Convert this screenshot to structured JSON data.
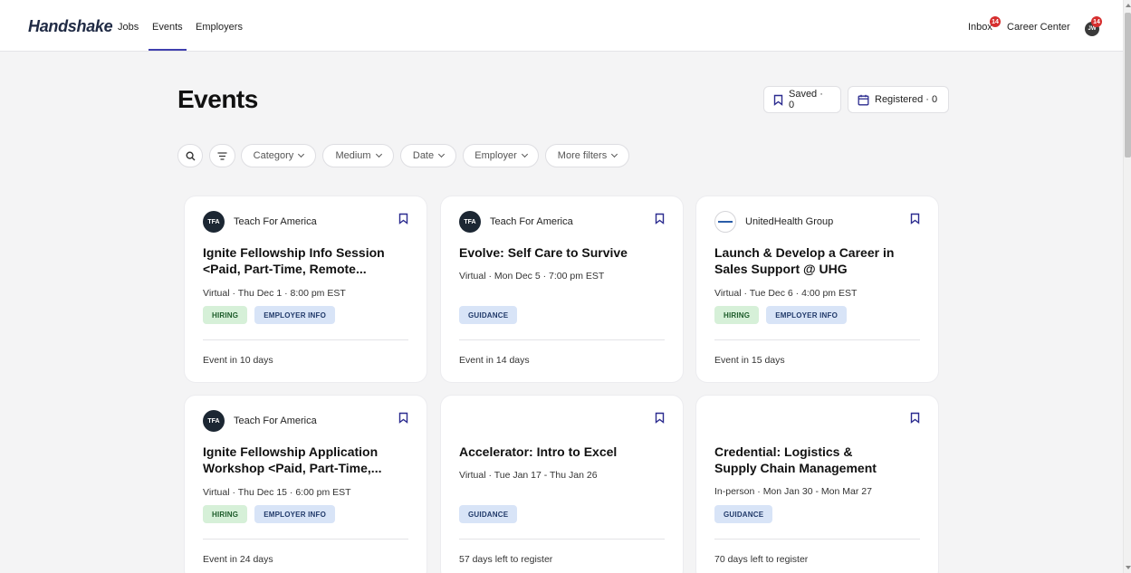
{
  "nav": {
    "logo": "Handshake",
    "links": [
      "Jobs",
      "Events",
      "Employers"
    ],
    "inbox_label": "Inbox",
    "inbox_badge": "14",
    "career_center_label": "Career Center",
    "avatar_initials": "JW",
    "avatar_badge": "14"
  },
  "header": {
    "title": "Events",
    "saved_label": "Saved · 0",
    "registered_label": "Registered · 0"
  },
  "filters": {
    "search_icon": "search-icon",
    "sort_icon": "sort-icon",
    "items": [
      "Category",
      "Medium",
      "Date",
      "Employer",
      "More filters"
    ]
  },
  "cards": [
    {
      "org": "Teach For America",
      "org_logo_text": "TFA",
      "title_line1": "Ignite Fellowship Info Session",
      "title_line2": "<Paid, Part-Time, Remote...",
      "meta": "Virtual · Thu Dec 1 · 8:00 pm EST",
      "tags": [
        "HIRING",
        "EMPLOYER INFO"
      ],
      "footer": "Event in 10 days"
    },
    {
      "org": "Teach For America",
      "org_logo_text": "TFA",
      "title_line1": "Evolve: Self Care to Survive",
      "title_line2": "",
      "meta": "Virtual · Mon Dec 5 · 7:00 pm EST",
      "tags": [
        "GUIDANCE"
      ],
      "footer": "Event in 14 days"
    },
    {
      "org": "UnitedHealth Group",
      "org_logo_text": "",
      "title_line1": "Launch & Develop a Career in",
      "title_line2": "Sales Support @ UHG",
      "meta": "Virtual · Tue Dec 6 · 4:00 pm EST",
      "tags": [
        "HIRING",
        "EMPLOYER INFO"
      ],
      "footer": "Event in 15 days"
    },
    {
      "org": "Teach For America",
      "org_logo_text": "TFA",
      "title_line1": "Ignite Fellowship Application",
      "title_line2": "Workshop <Paid, Part-Time,...",
      "meta": "Virtual · Thu Dec 15 · 6:00 pm EST",
      "tags": [
        "HIRING",
        "EMPLOYER INFO"
      ],
      "footer": "Event in 24 days"
    },
    {
      "org": "",
      "org_logo_text": "",
      "title_line1": "Accelerator: Intro to Excel",
      "title_line2": "",
      "meta": "Virtual · Tue Jan 17 - Thu Jan 26",
      "tags": [
        "GUIDANCE"
      ],
      "footer": "57 days left to register"
    },
    {
      "org": "",
      "org_logo_text": "",
      "title_line1": "Credential: Logistics &",
      "title_line2": "Supply Chain Management",
      "meta": "In-person · Mon Jan 30 - Mon Mar 27",
      "tags": [
        "GUIDANCE"
      ],
      "footer": "70 days left to register"
    }
  ],
  "colors": {
    "accent": "#3f3fae",
    "page_bg": "#f4f4f5",
    "hiring_bg": "#d6f0d8",
    "info_bg": "#d8e4f7",
    "badge_red": "#d62f2f"
  }
}
